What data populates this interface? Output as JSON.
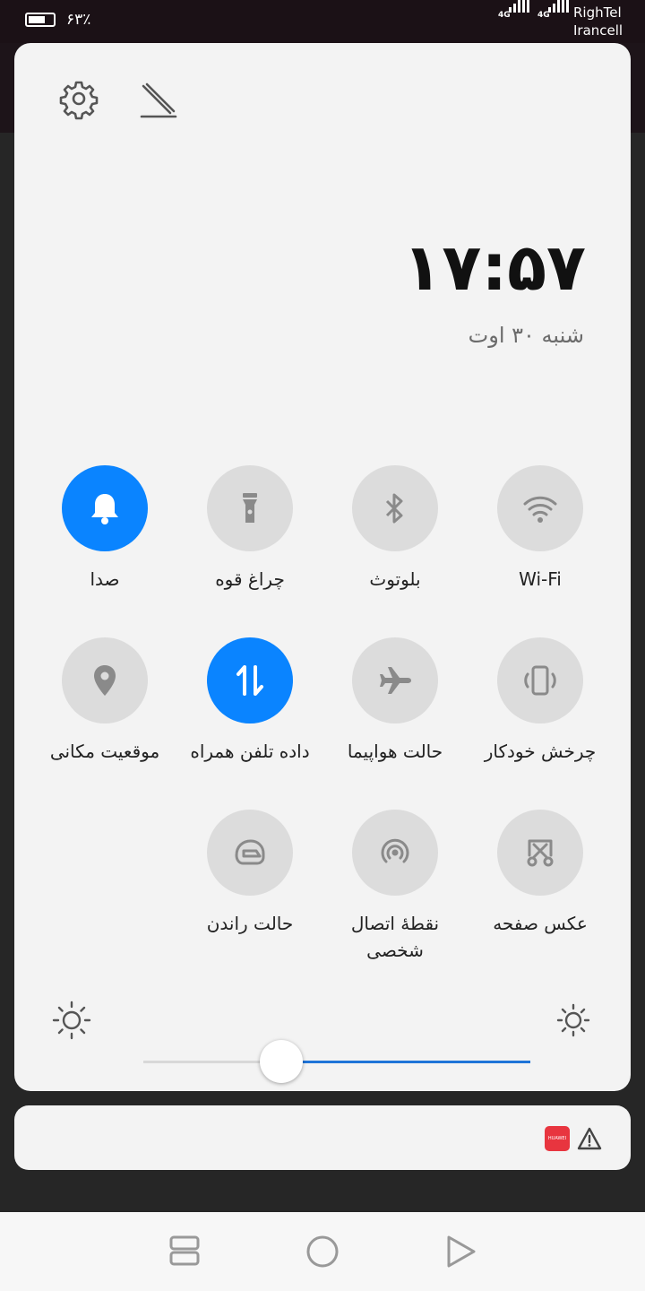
{
  "status_bar": {
    "battery_percent": "۶۳٪",
    "sim1_tech": "4G",
    "sim2_tech": "4G",
    "carrier_1": "RighTel",
    "carrier_2": "Irancell"
  },
  "header": {
    "settings_icon": "gear-icon",
    "edit_icon": "pencil-icon",
    "time": "۱۷:۵۷",
    "date": "شنبه ۳۰ اوت"
  },
  "quick_settings": {
    "tiles": [
      {
        "id": "sound",
        "label": "صدا",
        "icon": "bell-icon",
        "active": true
      },
      {
        "id": "flashlight",
        "label": "چراغ قوه",
        "icon": "flashlight-icon",
        "active": false
      },
      {
        "id": "bluetooth",
        "label": "بلوتوث",
        "icon": "bluetooth-icon",
        "active": false
      },
      {
        "id": "wifi",
        "label": "Wi-Fi",
        "icon": "wifi-icon",
        "active": false
      },
      {
        "id": "location",
        "label": "موقعیت مکانی",
        "icon": "location-pin-icon",
        "active": false
      },
      {
        "id": "mobile-data",
        "label": "داده تلفن همراه",
        "icon": "data-arrows-icon",
        "active": true
      },
      {
        "id": "airplane",
        "label": "حالت هواپیما",
        "icon": "airplane-icon",
        "active": false
      },
      {
        "id": "auto-rotate",
        "label": "چرخش خودکار",
        "icon": "rotate-phone-icon",
        "active": false
      },
      {
        "id": "driving",
        "label": "حالت راندن",
        "icon": "helmet-icon",
        "active": false
      },
      {
        "id": "hotspot",
        "label": "نقطهٔ اتصال شخصی",
        "icon": "hotspot-icon",
        "active": false
      },
      {
        "id": "screenshot",
        "label": "عکس صفحه",
        "icon": "screenshot-scissors-icon",
        "active": false
      }
    ],
    "brightness_fraction": 0.36
  },
  "notification": {
    "app_icon_text": "HUAWEI",
    "warning_icon": "warning-triangle-icon"
  },
  "navigation": {
    "recents_icon": "recents-icon",
    "home_icon": "home-circle-icon",
    "back_icon": "back-triangle-icon"
  },
  "colors": {
    "accent": "#0a84ff",
    "tile_off": "#dcdcdc",
    "panel_bg": "#f3f3f3",
    "slider_active": "#1f74d8"
  }
}
